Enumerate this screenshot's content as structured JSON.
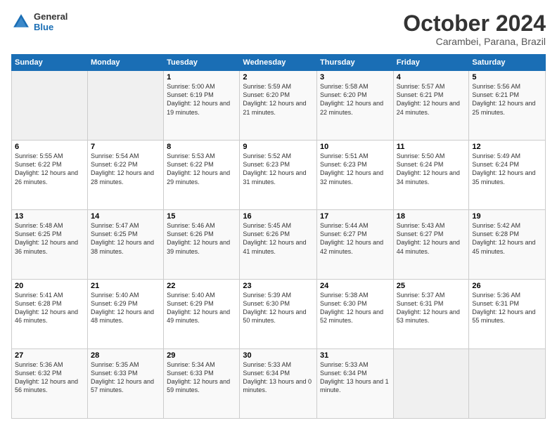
{
  "logo": {
    "general": "General",
    "blue": "Blue"
  },
  "header": {
    "month": "October 2024",
    "location": "Carambei, Parana, Brazil"
  },
  "days_of_week": [
    "Sunday",
    "Monday",
    "Tuesday",
    "Wednesday",
    "Thursday",
    "Friday",
    "Saturday"
  ],
  "weeks": [
    [
      {
        "day": "",
        "info": ""
      },
      {
        "day": "",
        "info": ""
      },
      {
        "day": "1",
        "sunrise": "5:00 AM",
        "sunset": "6:19 PM",
        "daylight": "12 hours and 19 minutes."
      },
      {
        "day": "2",
        "sunrise": "5:59 AM",
        "sunset": "6:20 PM",
        "daylight": "12 hours and 21 minutes."
      },
      {
        "day": "3",
        "sunrise": "5:58 AM",
        "sunset": "6:20 PM",
        "daylight": "12 hours and 22 minutes."
      },
      {
        "day": "4",
        "sunrise": "5:57 AM",
        "sunset": "6:21 PM",
        "daylight": "12 hours and 24 minutes."
      },
      {
        "day": "5",
        "sunrise": "5:56 AM",
        "sunset": "6:21 PM",
        "daylight": "12 hours and 25 minutes."
      }
    ],
    [
      {
        "day": "6",
        "sunrise": "5:55 AM",
        "sunset": "6:22 PM",
        "daylight": "12 hours and 26 minutes."
      },
      {
        "day": "7",
        "sunrise": "5:54 AM",
        "sunset": "6:22 PM",
        "daylight": "12 hours and 28 minutes."
      },
      {
        "day": "8",
        "sunrise": "5:53 AM",
        "sunset": "6:22 PM",
        "daylight": "12 hours and 29 minutes."
      },
      {
        "day": "9",
        "sunrise": "5:52 AM",
        "sunset": "6:23 PM",
        "daylight": "12 hours and 31 minutes."
      },
      {
        "day": "10",
        "sunrise": "5:51 AM",
        "sunset": "6:23 PM",
        "daylight": "12 hours and 32 minutes."
      },
      {
        "day": "11",
        "sunrise": "5:50 AM",
        "sunset": "6:24 PM",
        "daylight": "12 hours and 34 minutes."
      },
      {
        "day": "12",
        "sunrise": "5:49 AM",
        "sunset": "6:24 PM",
        "daylight": "12 hours and 35 minutes."
      }
    ],
    [
      {
        "day": "13",
        "sunrise": "5:48 AM",
        "sunset": "6:25 PM",
        "daylight": "12 hours and 36 minutes."
      },
      {
        "day": "14",
        "sunrise": "5:47 AM",
        "sunset": "6:25 PM",
        "daylight": "12 hours and 38 minutes."
      },
      {
        "day": "15",
        "sunrise": "5:46 AM",
        "sunset": "6:26 PM",
        "daylight": "12 hours and 39 minutes."
      },
      {
        "day": "16",
        "sunrise": "5:45 AM",
        "sunset": "6:26 PM",
        "daylight": "12 hours and 41 minutes."
      },
      {
        "day": "17",
        "sunrise": "5:44 AM",
        "sunset": "6:27 PM",
        "daylight": "12 hours and 42 minutes."
      },
      {
        "day": "18",
        "sunrise": "5:43 AM",
        "sunset": "6:27 PM",
        "daylight": "12 hours and 44 minutes."
      },
      {
        "day": "19",
        "sunrise": "5:42 AM",
        "sunset": "6:28 PM",
        "daylight": "12 hours and 45 minutes."
      }
    ],
    [
      {
        "day": "20",
        "sunrise": "5:41 AM",
        "sunset": "6:28 PM",
        "daylight": "12 hours and 46 minutes."
      },
      {
        "day": "21",
        "sunrise": "5:40 AM",
        "sunset": "6:29 PM",
        "daylight": "12 hours and 48 minutes."
      },
      {
        "day": "22",
        "sunrise": "5:40 AM",
        "sunset": "6:29 PM",
        "daylight": "12 hours and 49 minutes."
      },
      {
        "day": "23",
        "sunrise": "5:39 AM",
        "sunset": "6:30 PM",
        "daylight": "12 hours and 50 minutes."
      },
      {
        "day": "24",
        "sunrise": "5:38 AM",
        "sunset": "6:30 PM",
        "daylight": "12 hours and 52 minutes."
      },
      {
        "day": "25",
        "sunrise": "5:37 AM",
        "sunset": "6:31 PM",
        "daylight": "12 hours and 53 minutes."
      },
      {
        "day": "26",
        "sunrise": "5:36 AM",
        "sunset": "6:31 PM",
        "daylight": "12 hours and 55 minutes."
      }
    ],
    [
      {
        "day": "27",
        "sunrise": "5:36 AM",
        "sunset": "6:32 PM",
        "daylight": "12 hours and 56 minutes."
      },
      {
        "day": "28",
        "sunrise": "5:35 AM",
        "sunset": "6:33 PM",
        "daylight": "12 hours and 57 minutes."
      },
      {
        "day": "29",
        "sunrise": "5:34 AM",
        "sunset": "6:33 PM",
        "daylight": "12 hours and 59 minutes."
      },
      {
        "day": "30",
        "sunrise": "5:33 AM",
        "sunset": "6:34 PM",
        "daylight": "13 hours and 0 minutes."
      },
      {
        "day": "31",
        "sunrise": "5:33 AM",
        "sunset": "6:34 PM",
        "daylight": "13 hours and 1 minute."
      },
      {
        "day": "",
        "info": ""
      },
      {
        "day": "",
        "info": ""
      }
    ]
  ],
  "labels": {
    "sunrise": "Sunrise:",
    "sunset": "Sunset:",
    "daylight": "Daylight:"
  }
}
